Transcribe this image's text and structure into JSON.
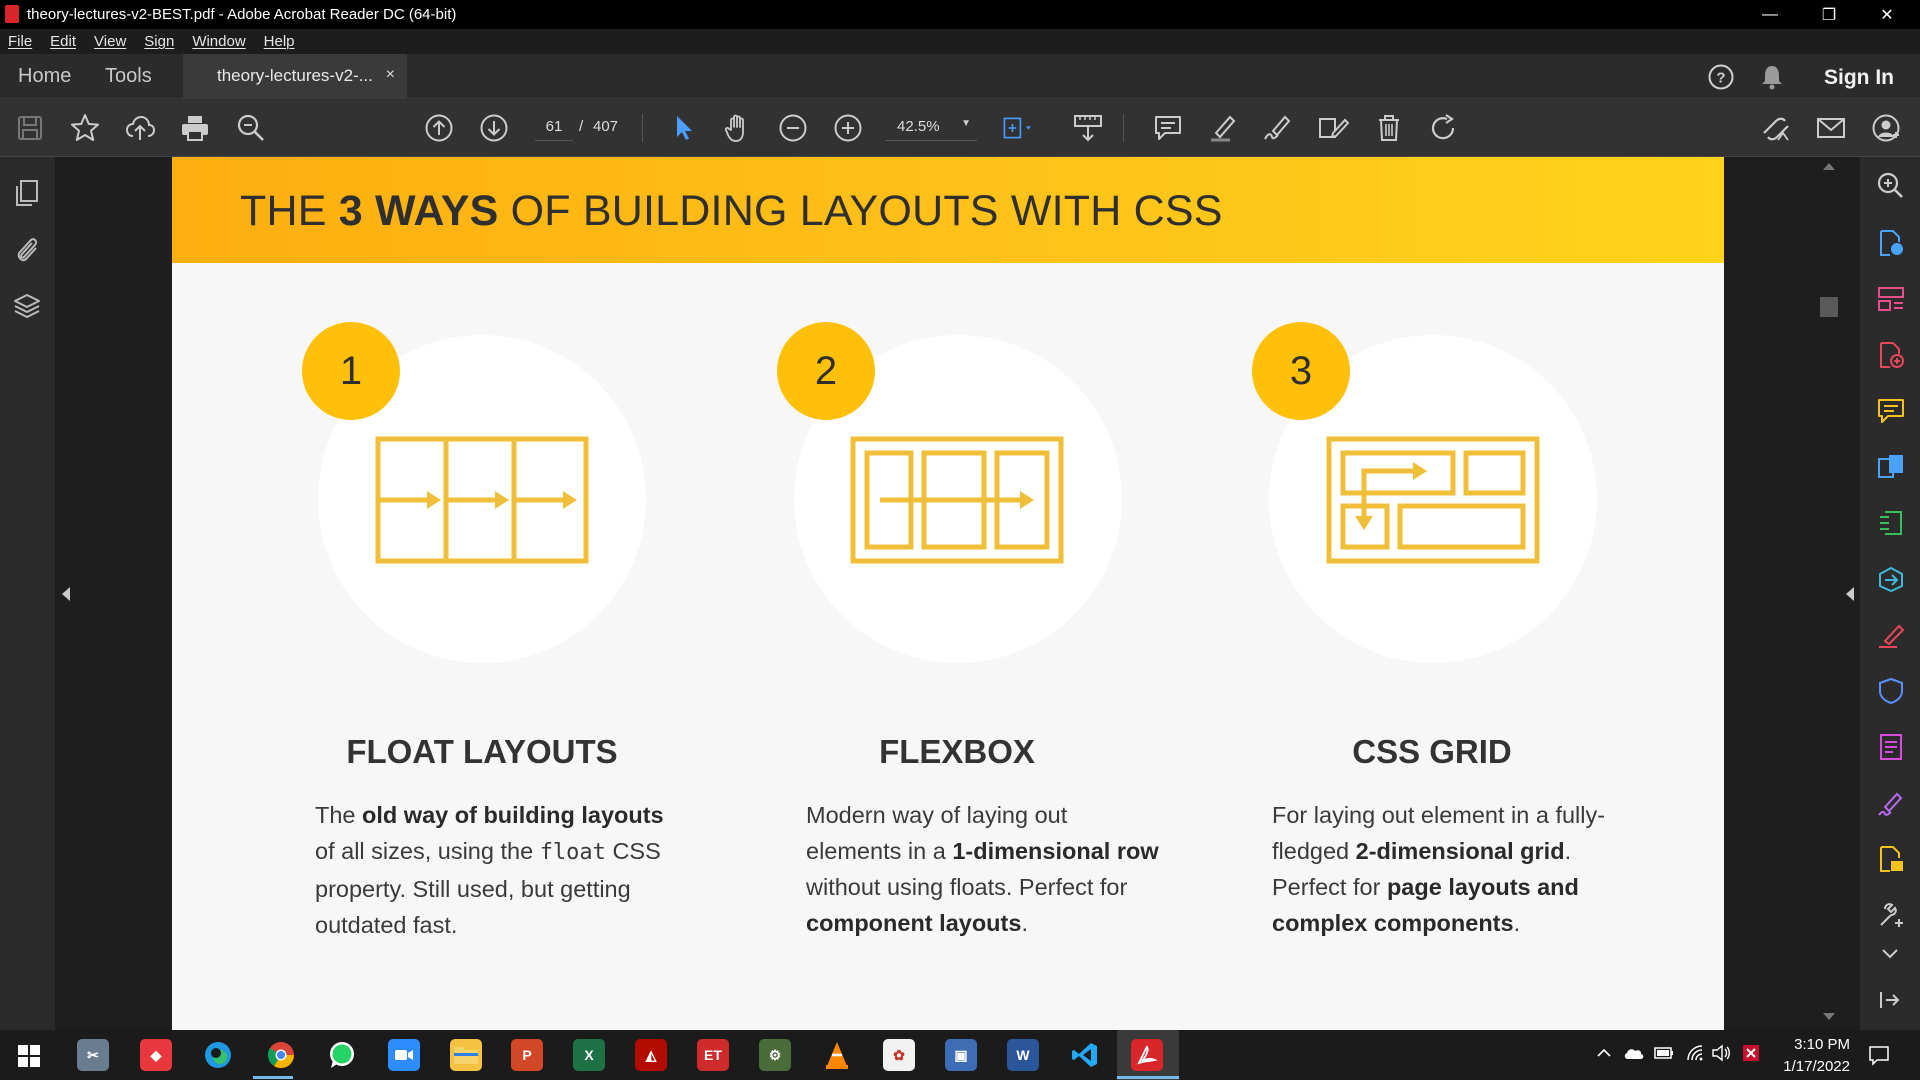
{
  "window": {
    "title": "theory-lectures-v2-BEST.pdf - Adobe Acrobat Reader DC (64-bit)",
    "minimize": "—",
    "restore": "❐",
    "close": "✕"
  },
  "menu": [
    "File",
    "Edit",
    "View",
    "Sign",
    "Window",
    "Help"
  ],
  "tabs": {
    "home": "Home",
    "tools": "Tools",
    "document": "theory-lectures-v2-...",
    "close": "×",
    "sign_in": "Sign In"
  },
  "toolbar": {
    "current_page": "61",
    "page_separator": "/",
    "total_pages": "407",
    "zoom": "42.5%"
  },
  "slide": {
    "title_pre": "THE ",
    "title_bold": "3 WAYS",
    "title_post": " OF BUILDING LAYOUTS WITH CSS",
    "columns": [
      {
        "number": "1",
        "heading": "FLOAT LAYOUTS",
        "icon": "float-layout-icon",
        "text": [
          {
            "t": "The ",
            "b": false
          },
          {
            "t": "old way of building layouts",
            "b": true
          },
          {
            "t": " of all sizes, using the ",
            "b": false
          },
          {
            "t": "float",
            "b": false,
            "mono": true
          },
          {
            "t": " CSS property. Still used, but getting outdated fast.",
            "b": false
          }
        ]
      },
      {
        "number": "2",
        "heading": "FLEXBOX",
        "icon": "flexbox-layout-icon",
        "text": [
          {
            "t": "Modern way of laying out elements in a ",
            "b": false
          },
          {
            "t": "1-dimensional row",
            "b": true
          },
          {
            "t": " without using floats. Perfect for ",
            "b": false
          },
          {
            "t": "component layouts",
            "b": true
          },
          {
            "t": ".",
            "b": false
          }
        ]
      },
      {
        "number": "3",
        "heading": "CSS GRID",
        "icon": "grid-layout-icon",
        "text": [
          {
            "t": "For laying out element in a fully-fledged ",
            "b": false
          },
          {
            "t": "2-dimensional grid",
            "b": true
          },
          {
            "t": ". Perfect for ",
            "b": false
          },
          {
            "t": "page layouts and complex components",
            "b": true
          },
          {
            "t": ".",
            "b": false
          }
        ]
      }
    ]
  },
  "colors": {
    "accent": "#ffc00a",
    "icon_gold": "#f0bf3a",
    "dark_text": "#333333"
  },
  "taskbar": {
    "time": "3:10 PM",
    "date": "1/17/2022"
  }
}
